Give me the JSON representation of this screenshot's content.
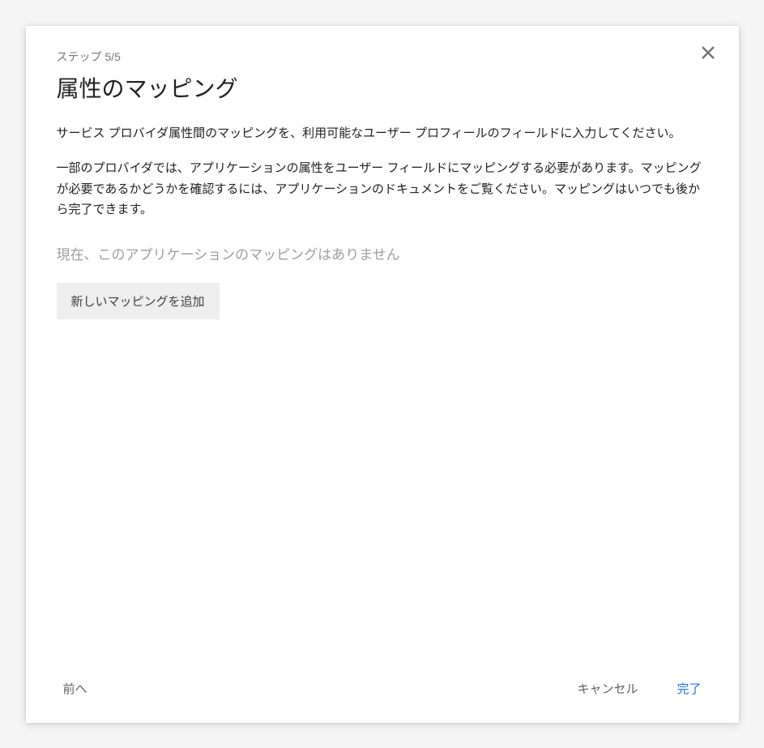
{
  "header": {
    "step_indicator": "ステップ 5/5",
    "title": "属性のマッピング"
  },
  "body": {
    "description_1": "サービス プロバイダ属性間のマッピングを、利用可能なユーザー プロフィールのフィールドに入力してください。",
    "description_2": "一部のプロバイダでは、アプリケーションの属性をユーザー フィールドにマッピングする必要があります。マッピングが必要であるかどうかを確認するには、アプリケーションのドキュメントをご覧ください。マッピングはいつでも後から完了できます。",
    "empty_state": "現在、このアプリケーションのマッピングはありません",
    "add_mapping_label": "新しいマッピングを追加"
  },
  "footer": {
    "back_label": "前へ",
    "cancel_label": "キャンセル",
    "finish_label": "完了"
  }
}
